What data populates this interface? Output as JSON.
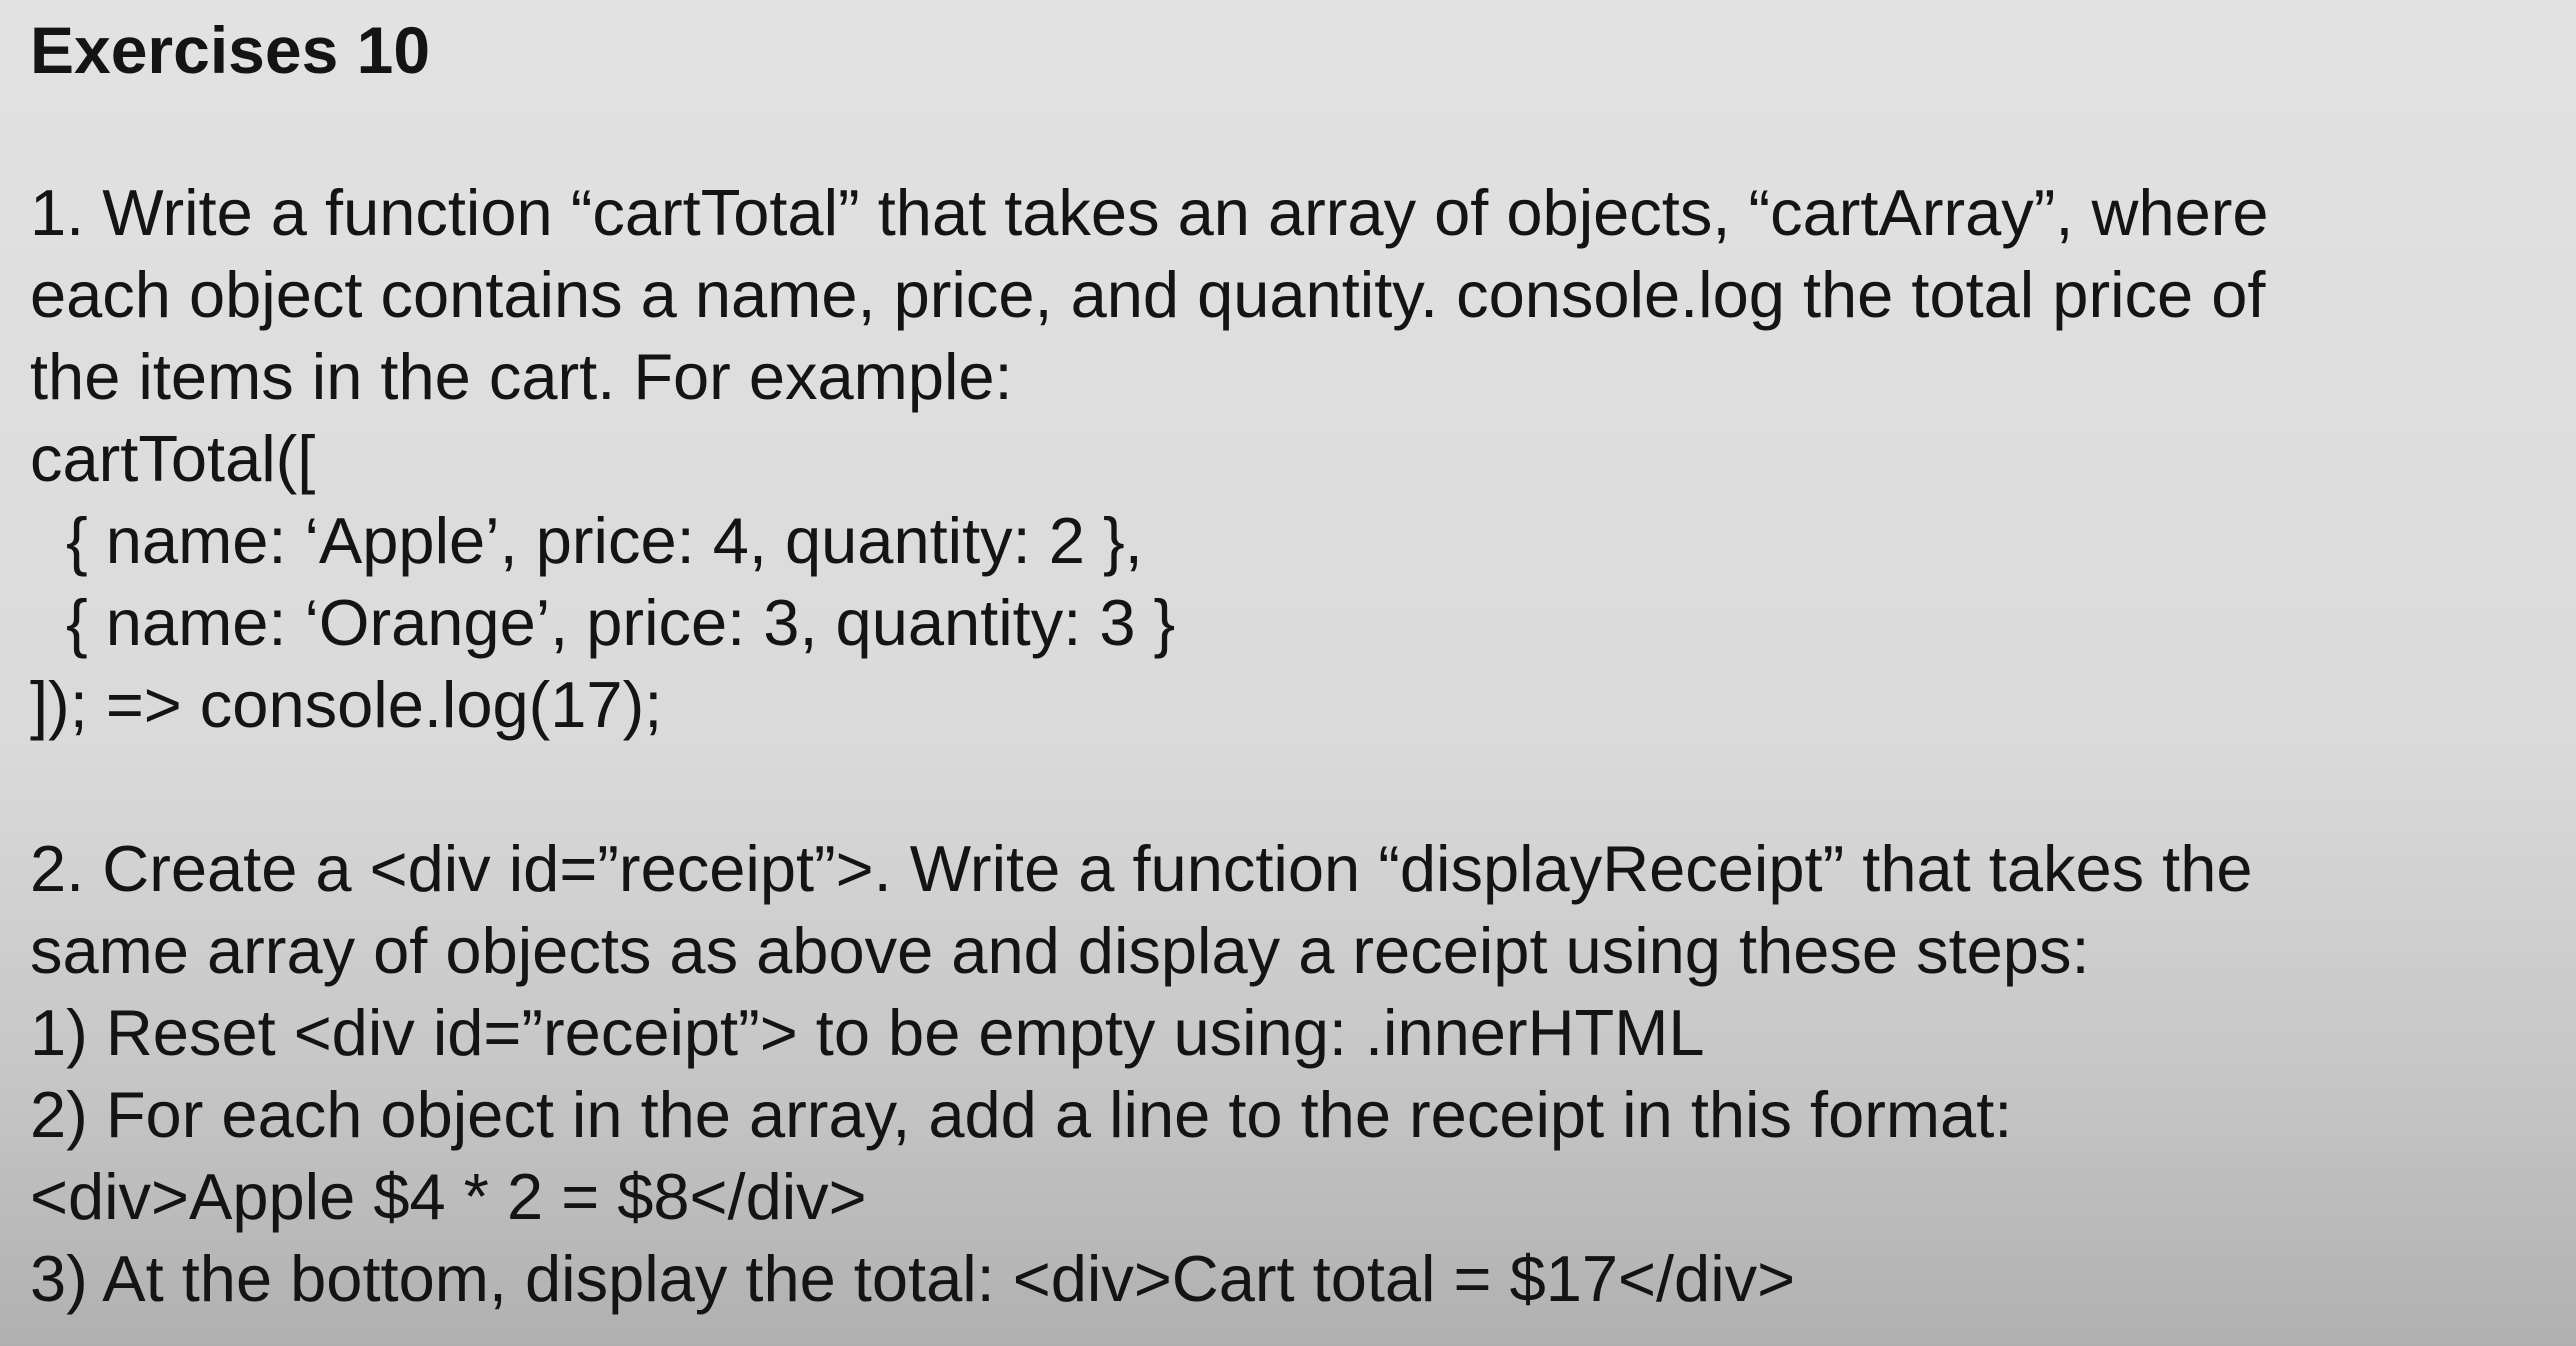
{
  "title": "Exercises 10",
  "exercise1": {
    "lines": [
      "1. Write a function “cartTotal” that takes an array of objects, “cartArray”, where",
      "each object contains a name, price, and quantity. console.log the total price of",
      "the items in the cart. For example:",
      "cartTotal([",
      "{ name: ‘Apple’, price: 4, quantity: 2 },",
      "{ name: ‘Orange’, price: 3, quantity: 3 }",
      "]); => console.log(17);"
    ]
  },
  "exercise2": {
    "lines": [
      "2. Create a <div id=”receipt”>. Write a function “displayReceipt” that takes the",
      "same array of objects as above and display a receipt using these steps:",
      "1) Reset <div id=”receipt”> to be empty using: .innerHTML",
      "2) For each object in the array, add a line to the receipt in this format:",
      "<div>Apple $4 * 2 = $8</div>",
      "3) At the bottom, display the total: <div>Cart total = $17</div>"
    ]
  }
}
